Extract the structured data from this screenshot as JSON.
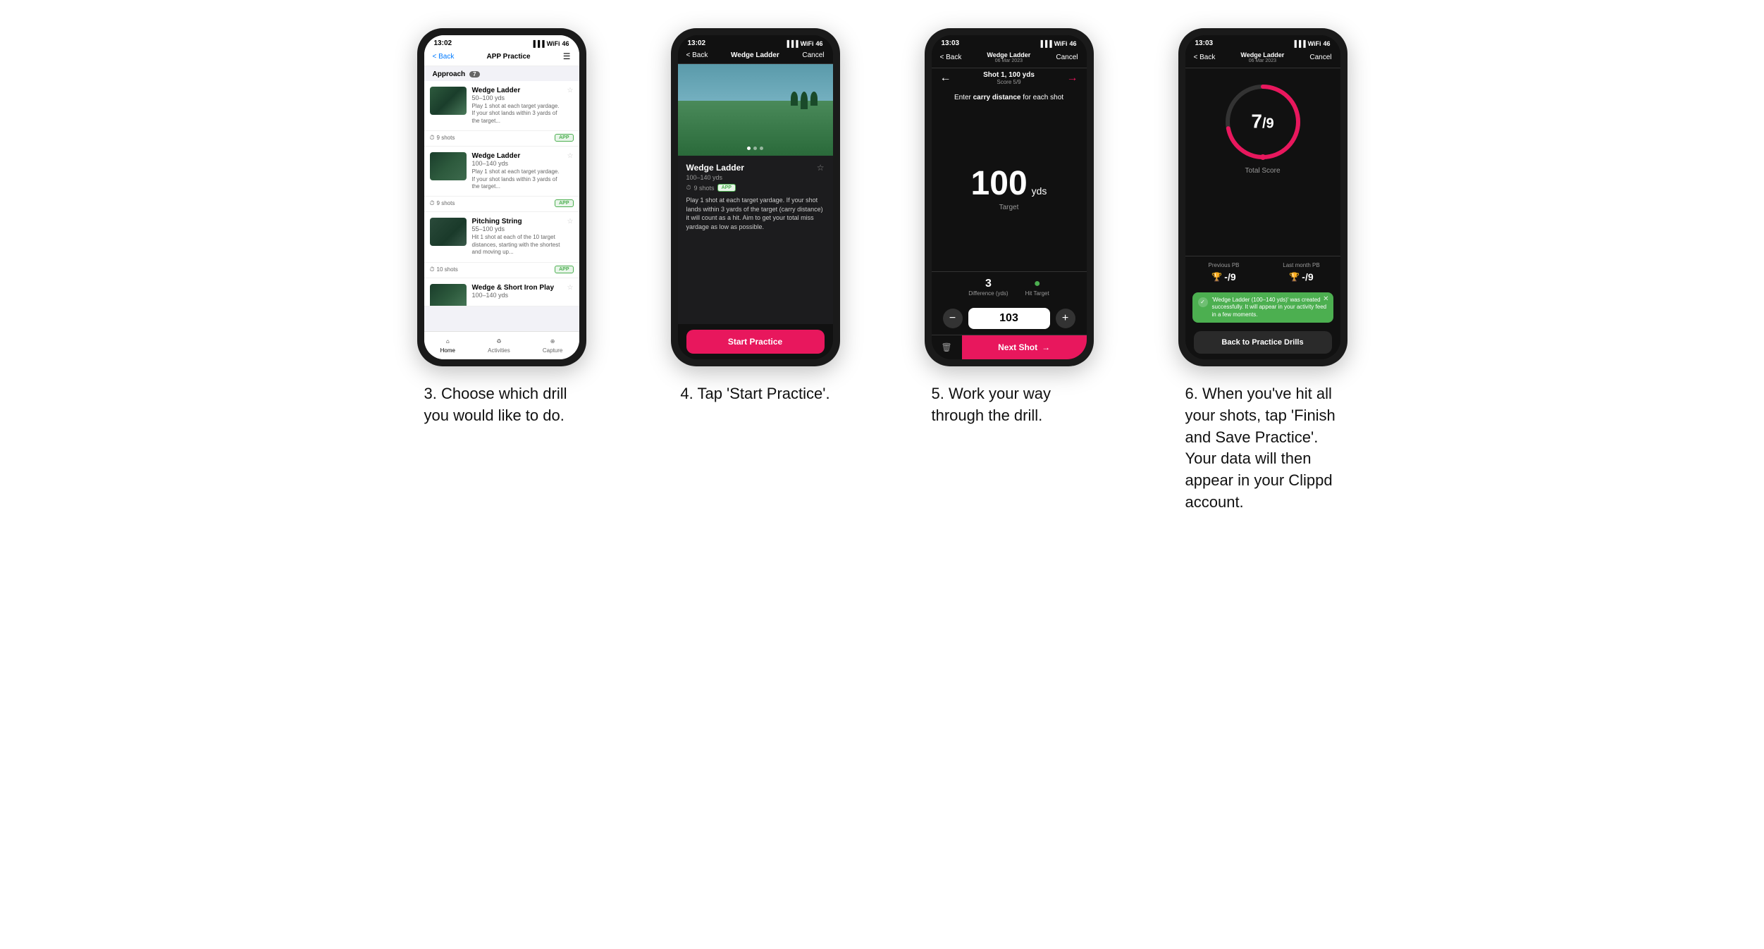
{
  "page": {
    "background": "#ffffff"
  },
  "phone1": {
    "status_time": "13:02",
    "nav_back": "< Back",
    "nav_title": "APP Practice",
    "section_label": "Approach",
    "section_count": "7",
    "drills": [
      {
        "name": "Wedge Ladder",
        "yds": "50–100 yds",
        "desc": "Play 1 shot at each target yardage. If your shot lands within 3 yards of the target...",
        "shots": "9 shots",
        "badge": "APP"
      },
      {
        "name": "Wedge Ladder",
        "yds": "100–140 yds",
        "desc": "Play 1 shot at each target yardage. If your shot lands within 3 yards of the target...",
        "shots": "9 shots",
        "badge": "APP"
      },
      {
        "name": "Pitching String",
        "yds": "55–100 yds",
        "desc": "Hit 1 shot at each of the 10 target distances, starting with the shortest and moving up...",
        "shots": "10 shots",
        "badge": "APP"
      },
      {
        "name": "Wedge & Short Iron Play",
        "yds": "100–140 yds",
        "shots": "",
        "badge": ""
      }
    ],
    "tabs": [
      "Home",
      "Activities",
      "Capture"
    ],
    "caption": "3. Choose which drill you would like to do."
  },
  "phone2": {
    "status_time": "13:02",
    "nav_back": "< Back",
    "nav_title": "Wedge Ladder",
    "nav_cancel": "Cancel",
    "drill_name": "Wedge Ladder",
    "drill_yds": "100–140 yds",
    "drill_shots": "9 shots",
    "drill_badge": "APP",
    "drill_desc": "Play 1 shot at each target yardage. If your shot lands within 3 yards of the target (carry distance) it will count as a hit. Aim to get your total miss yardage as low as possible.",
    "start_btn": "Start Practice",
    "caption": "4. Tap 'Start Practice'."
  },
  "phone3": {
    "status_time": "13:03",
    "nav_back": "< Back",
    "nav_title": "Wedge Ladder",
    "nav_date": "06 Mar 2023",
    "nav_cancel": "Cancel",
    "shot_label": "Shot 1, 100 yds",
    "score_label": "Score 5/9",
    "carry_text": "Enter carry distance for each shot",
    "target_value": "100",
    "target_unit": "yds",
    "target_label": "Target",
    "difference_value": "3",
    "difference_label": "Difference (yds)",
    "hit_target_label": "Hit Target",
    "input_value": "103",
    "next_shot": "Next Shot",
    "caption": "5. Work your way through the drill."
  },
  "phone4": {
    "status_time": "13:03",
    "nav_back": "< Back",
    "nav_title": "Wedge Ladder",
    "nav_date": "06 Mar 2023",
    "nav_cancel": "Cancel",
    "score_numerator": "7",
    "score_denominator": "/9",
    "score_label": "Total Score",
    "previous_pb_label": "Previous PB",
    "previous_pb_value": "-/9",
    "last_month_pb_label": "Last month PB",
    "last_month_pb_value": "-/9",
    "toast_text": "'Wedge Ladder (100–140 yds)' was created successfully. It will appear in your activity feed in a few moments.",
    "back_btn": "Back to Practice Drills",
    "caption": "6. When you've hit all your shots, tap 'Finish and Save Practice'. Your data will then appear in your Clippd account."
  }
}
